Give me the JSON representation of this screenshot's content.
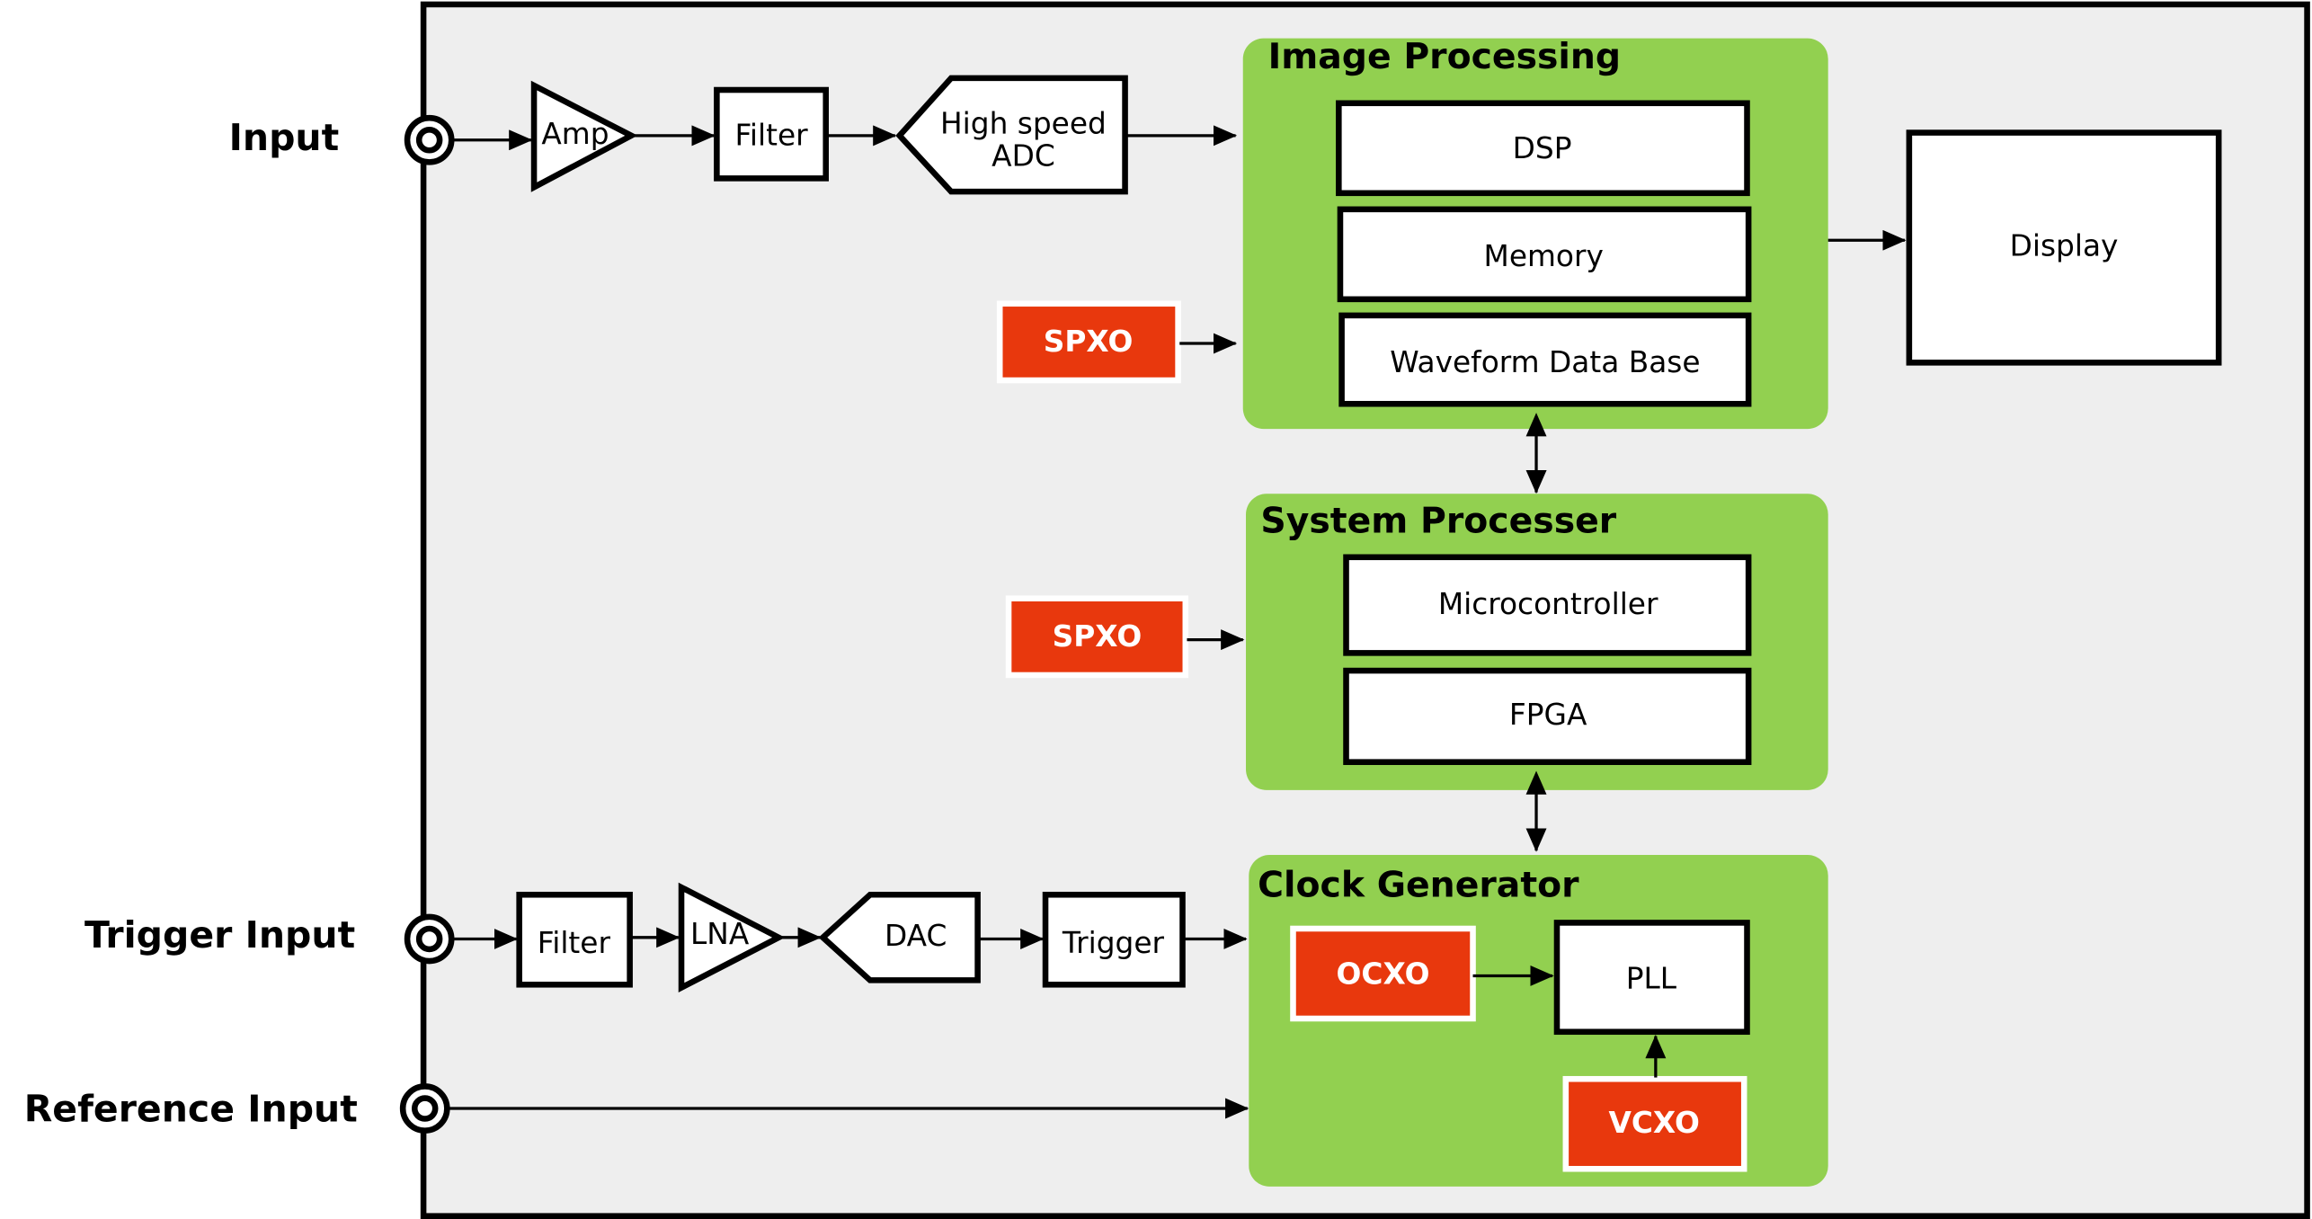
{
  "colors": {
    "group_fill": "#92d050",
    "oscillator_fill": "#e8380d",
    "background": "#eeeeee"
  },
  "inputs": {
    "input": "Input",
    "trigger": "Trigger Input",
    "reference": "Reference Input"
  },
  "signal_chain": {
    "amp": "Amp",
    "filter": "Filter",
    "adc_line1": "High speed",
    "adc_line2": "ADC"
  },
  "trigger_chain": {
    "filter": "Filter",
    "lna": "LNA",
    "dac": "DAC",
    "trigger": "Trigger"
  },
  "image_processing": {
    "title": "Image Processing",
    "dsp": "DSP",
    "memory": "Memory",
    "waveform_db": "Waveform Data Base",
    "oscillator": "SPXO"
  },
  "display": "Display",
  "system_processor": {
    "title": "System Processer",
    "microcontroller": "Microcontroller",
    "fpga": "FPGA",
    "oscillator": "SPXO"
  },
  "clock_generator": {
    "title": "Clock Generator",
    "ocxo": "OCXO",
    "pll": "PLL",
    "vcxo": "VCXO"
  }
}
